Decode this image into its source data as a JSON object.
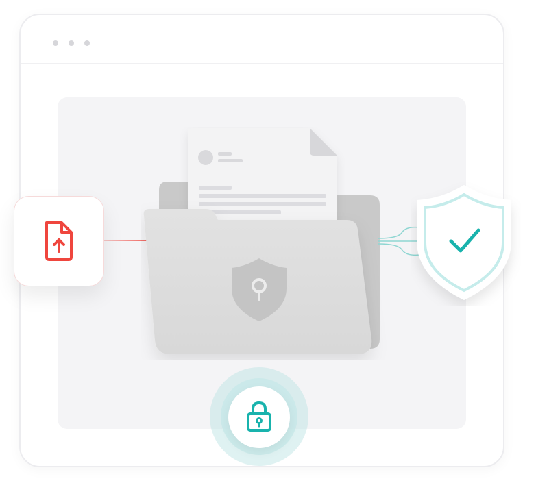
{
  "window": {
    "controls": [
      "dot",
      "dot",
      "dot"
    ]
  },
  "icons": {
    "upload": "file-upload-icon",
    "folder": "folder-icon",
    "document": "document-icon",
    "folder_shield": "shield-keyhole-icon",
    "verified": "shield-check-icon",
    "lock": "padlock-icon"
  },
  "colors": {
    "accent_teal": "#19b3ad",
    "accent_red": "#ef463e",
    "folder_gray": "#dcdcdc",
    "shield_gray": "#c4c4c4",
    "window_border": "#ececef",
    "content_bg": "#f4f4f6"
  }
}
